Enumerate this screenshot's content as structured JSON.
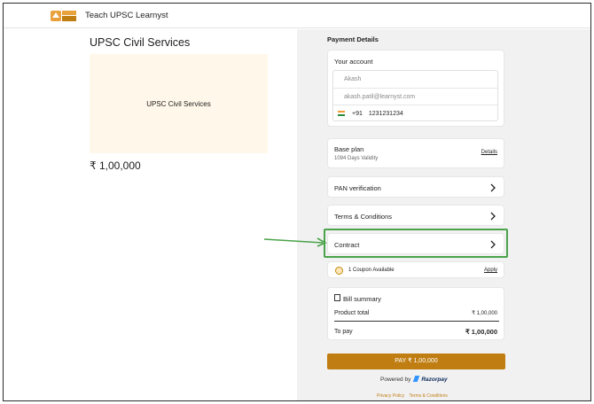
{
  "header": {
    "brand": "Teach UPSC Learnyst",
    "logo_text": "TEACH UPSC"
  },
  "course": {
    "title": "UPSC Civil Services",
    "thumbnail_label": "UPSC Civil Services",
    "price": "₹ 1,00,000"
  },
  "payment": {
    "heading": "Payment Details",
    "account": {
      "title": "Your account",
      "name_placeholder": "Akash",
      "email_placeholder": "akash.patil@learnyst.com",
      "country_code": "+91",
      "phone": "1231231234"
    },
    "plan": {
      "title": "Base plan",
      "validity": "1094 Days Validity",
      "details_link": "Details"
    },
    "rows": {
      "pan": "PAN verification",
      "terms": "Terms & Conditions",
      "contract": "Contract"
    },
    "coupon": {
      "text": "1 Coupon Available",
      "apply": "Apply"
    },
    "bill": {
      "title": "Bill summary",
      "product_total_label": "Product total",
      "product_total_value": "₹ 1,00,000",
      "to_pay_label": "To pay",
      "to_pay_value": "₹ 1,00,000"
    },
    "pay_button": "PAY ₹ 1,00,000",
    "powered_by": "Powered by",
    "razorpay": "Razorpay",
    "footer": {
      "privacy": "Privacy Policy",
      "terms": "Terms & Conditions"
    }
  },
  "colors": {
    "accent": "#c07e12",
    "highlight": "#4aa34a",
    "thumbnail_bg": "#fff7e9",
    "right_bg": "#f1f1f2"
  }
}
